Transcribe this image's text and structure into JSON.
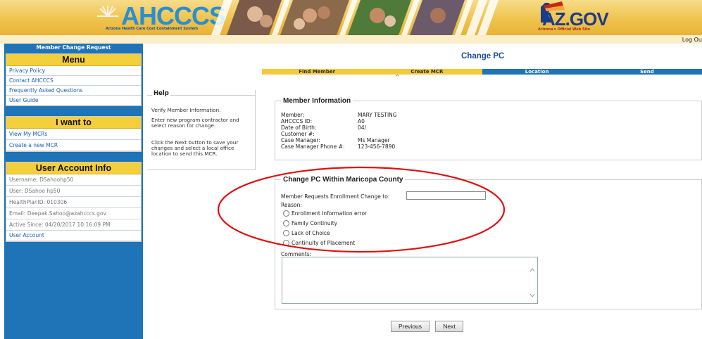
{
  "header": {
    "logo_text": "AHCCCS",
    "logo_subtitle": "Arizona Health Care Cost Containment System",
    "az_text": "AZ.GOV",
    "az_subtitle": "Arizona's Official Web Site",
    "logout": "Log Ou"
  },
  "sidebar": {
    "title": "Member Change Request",
    "menu_head": "Menu",
    "menu": [
      "Privacy Policy",
      "Contact AHCCCS",
      "Frequently Asked Questions",
      "User Guide"
    ],
    "iwant_head": "I want to",
    "iwant": [
      "View My MCRs",
      "Create a new MCR"
    ],
    "account_head": "User Account Info",
    "account": [
      "Username: DSahoohp50",
      "User: DSahoo hp50",
      "HealthPlanID: 010306",
      "Email: Deepak.Sahoo@azahcccs.gov",
      "Active Since: 04/20/2017 10:16:09 PM"
    ],
    "account_link": "User Account"
  },
  "page": {
    "title": "Change PC"
  },
  "steps": [
    {
      "label": "Find Member",
      "state": "done"
    },
    {
      "label": "Create MCR",
      "state": "done"
    },
    {
      "label": "Location",
      "state": "todo"
    },
    {
      "label": "Send",
      "state": "todo"
    }
  ],
  "help": {
    "title": "Help",
    "p1": "Verify Member Information.",
    "p2": "Enter new program contractor and select reason for change.",
    "p3": "Click the Next button to save your changes and select a local office location to send this MCR."
  },
  "member_info": {
    "legend": "Member Information",
    "labels": [
      "Member:",
      "AHCCCS ID:",
      "Date of Birth:",
      "Customer #:",
      "Case Manager:",
      "Case Manager Phone #:"
    ],
    "values": [
      "MARY TESTING",
      "A0",
      "04/",
      "",
      "Ms Manager",
      "123-456-7890"
    ]
  },
  "change_pc": {
    "legend": "Change PC Within Maricopa County",
    "enroll_label": "Member Requests Enrollment Change to:",
    "enroll_value": "",
    "reason_label": "Reason:",
    "reasons": [
      "Enrollment Information error",
      "Family Continuity",
      "Lack of Choice",
      "Continuity of Placement"
    ],
    "comments_label": "Comments:",
    "comments_value": ""
  },
  "buttons": {
    "previous": "Previous",
    "next": "Next"
  },
  "colors": {
    "brand_blue": "#1f73b7",
    "brand_gold": "#f4c93a",
    "title_blue": "#1b4f9a",
    "annotation_red": "#e01010"
  }
}
